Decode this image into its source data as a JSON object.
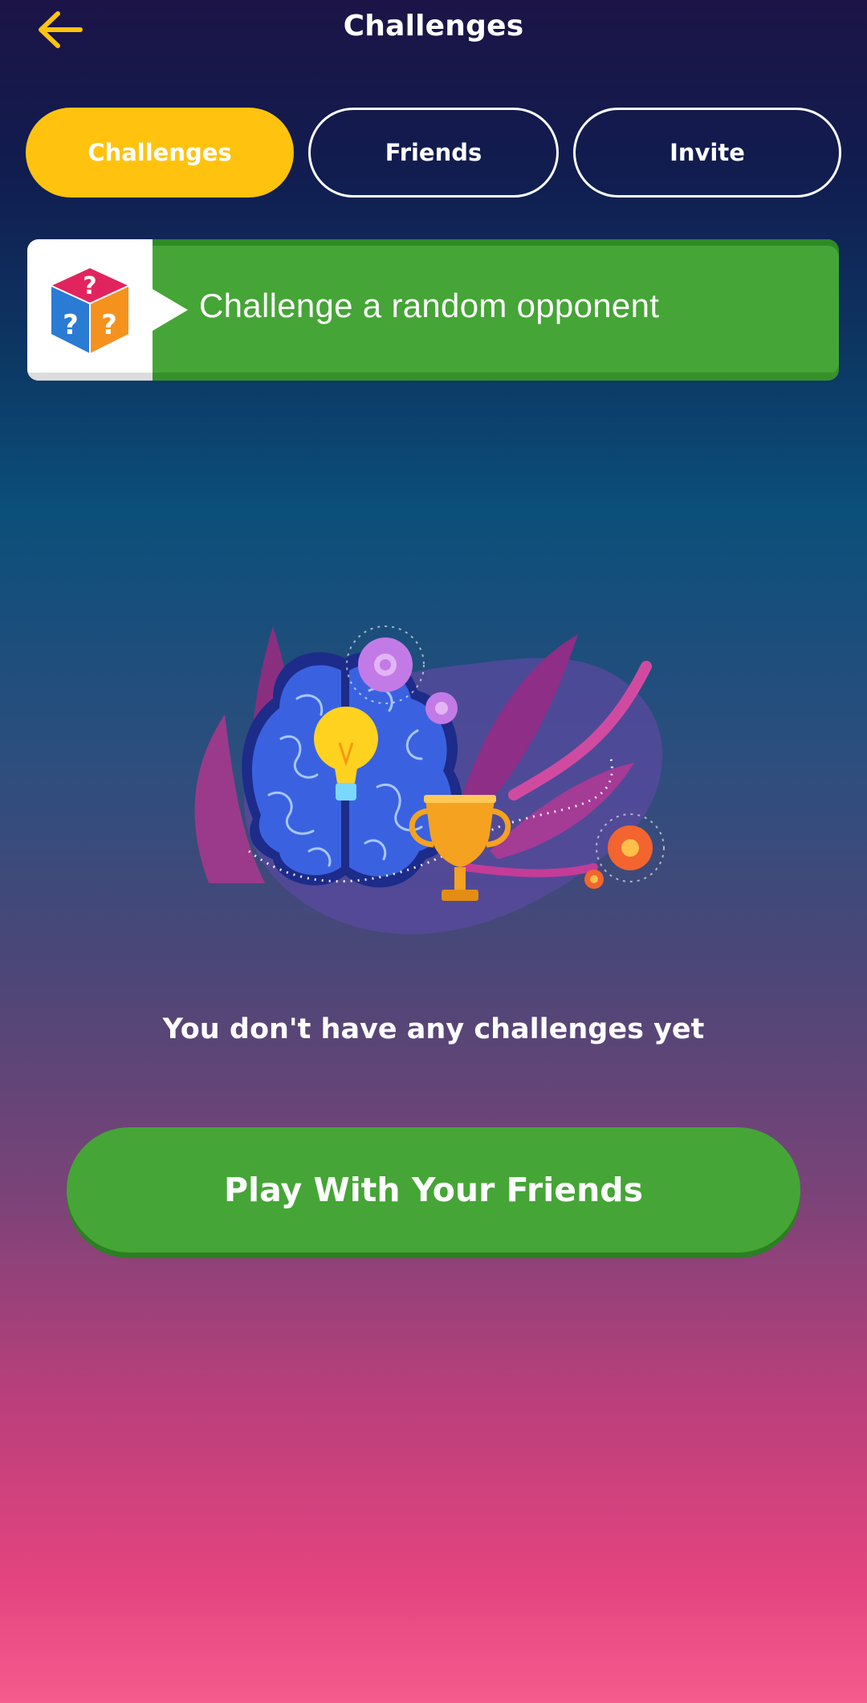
{
  "header": {
    "title": "Challenges",
    "back_icon": "arrow-left-icon",
    "accent_color": "#FFC30F"
  },
  "tabs": [
    {
      "label": "Challenges",
      "active": true
    },
    {
      "label": "Friends",
      "active": false
    },
    {
      "label": "Invite",
      "active": false
    }
  ],
  "random_challenge": {
    "label": "Challenge a random opponent",
    "icon": "question-cube-icon",
    "color": "#45A536"
  },
  "empty_state": {
    "illustration": "brain-lightbulb-trophy-illustration",
    "message": "You don't have any challenges yet"
  },
  "play_button": {
    "label": "Play With Your Friends",
    "color": "#45A536"
  }
}
